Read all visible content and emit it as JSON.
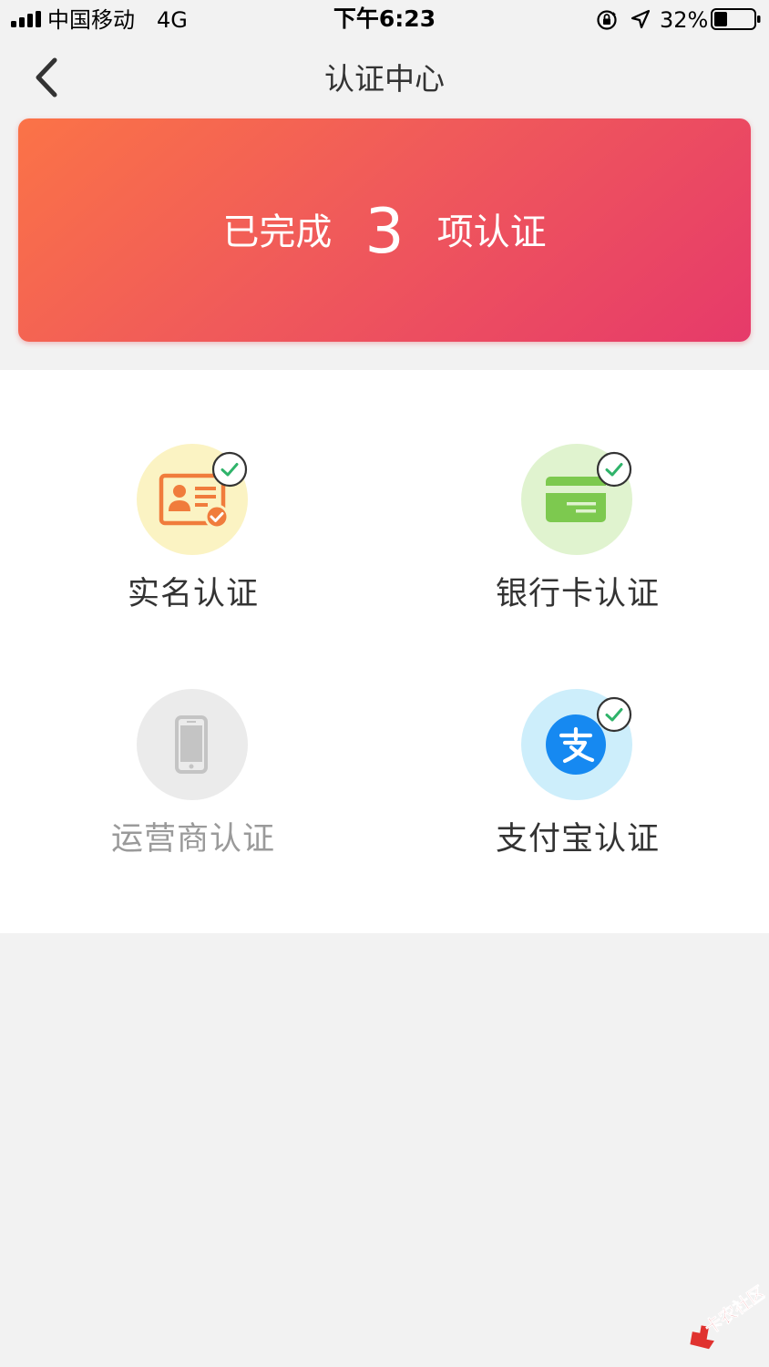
{
  "status_bar": {
    "carrier": "中国移动",
    "network": "4G",
    "time": "下午6:23",
    "battery": "32%"
  },
  "nav": {
    "title": "认证中心"
  },
  "banner": {
    "prefix": "已完成",
    "count": "3",
    "suffix": "项认证"
  },
  "certifications": [
    {
      "label": "实名认证",
      "icon": "id-card-icon",
      "completed": true,
      "color": "#fbf3c3",
      "accent": "#f07c3c"
    },
    {
      "label": "银行卡认证",
      "icon": "bank-card-icon",
      "completed": true,
      "color": "#e0f3cf",
      "accent": "#7dc94f"
    },
    {
      "label": "运营商认证",
      "icon": "phone-icon",
      "completed": false,
      "color": "#ebebeb",
      "accent": "#bdbdbd"
    },
    {
      "label": "支付宝认证",
      "icon": "alipay-icon",
      "completed": true,
      "color": "#cdeefb",
      "accent": "#1689f1"
    }
  ],
  "watermark": {
    "text": "卡农社区"
  }
}
